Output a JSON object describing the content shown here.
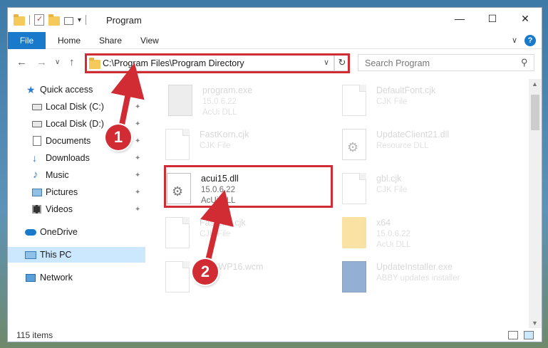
{
  "window": {
    "title": "Program",
    "minimize_glyph": "—",
    "maximize_glyph": "☐",
    "close_glyph": "✕"
  },
  "ribbon": {
    "file_tab": "File",
    "tabs": [
      "Home",
      "Share",
      "View"
    ],
    "help_glyph": "?",
    "expand_glyph": "∨"
  },
  "navigation": {
    "back_glyph": "←",
    "forward_glyph": "→",
    "recent_glyph": "∨",
    "up_glyph": "↑",
    "address": "C:\\Program Files\\Program Directory",
    "address_dropdown_glyph": "∨",
    "refresh_glyph": "↻",
    "search_placeholder": "Search Program",
    "search_glyph": "⚲"
  },
  "sidebar": {
    "items": [
      {
        "label": "Quick access",
        "icon": "star-icon"
      },
      {
        "label": "Local Disk (C:)",
        "icon": "drive-icon",
        "pinned": true
      },
      {
        "label": "Local Disk (D:)",
        "icon": "drive-icon",
        "pinned": true
      },
      {
        "label": "Documents",
        "icon": "documents-icon",
        "pinned": true
      },
      {
        "label": "Downloads",
        "icon": "download-icon",
        "pinned": true
      },
      {
        "label": "Music",
        "icon": "music-icon",
        "pinned": true
      },
      {
        "label": "Pictures",
        "icon": "pictures-icon",
        "pinned": true
      },
      {
        "label": "Videos",
        "icon": "videos-icon",
        "pinned": true
      },
      {
        "label": "OneDrive",
        "icon": "onedrive-icon"
      },
      {
        "label": "This PC",
        "icon": "pc-icon",
        "selected": true
      },
      {
        "label": "Network",
        "icon": "network-icon"
      }
    ],
    "pin_glyph": "📌"
  },
  "files": [
    {
      "name": "program.exe",
      "line1": "15.0.6.22",
      "line2": "AcUi DLL",
      "icon": "exe-icon"
    },
    {
      "name": "DefaultFont.cjk",
      "line1": "CJK File",
      "line2": "",
      "icon": "document-icon"
    },
    {
      "name": "FastKorn.cjk",
      "line1": "CJK File",
      "line2": "",
      "icon": "document-icon"
    },
    {
      "name": "UpdateClient21.dll",
      "line1": "Resource DLL",
      "line2": "",
      "icon": "dll-icon"
    },
    {
      "name": "acui15.dll",
      "line1": "15.0.6.22",
      "line2": "AcUi DLL",
      "icon": "dll-icon",
      "highlighted": true
    },
    {
      "name": "gbl.cjk",
      "line1": "CJK File",
      "line2": "",
      "icon": "document-icon"
    },
    {
      "name": "FastLtrd.cjk",
      "line1": "CJK File",
      "line2": "",
      "icon": "document-icon"
    },
    {
      "name": "x64",
      "line1": "15.0.6.22",
      "line2": "AcUi DLL",
      "icon": "folder-icon"
    },
    {
      "name": "ENUWP16.wcm",
      "line1": "",
      "line2": "",
      "icon": "document-icon"
    },
    {
      "name": "UpdateInstaller.exe",
      "line1": "ABBY updates installer",
      "line2": "",
      "icon": "installer-icon"
    }
  ],
  "status": {
    "item_count": "115 items"
  },
  "annotations": {
    "badge_1": "1",
    "badge_2": "2",
    "color": "#d12c34"
  },
  "colors": {
    "accent": "#1979ca",
    "selection": "#cce8ff",
    "highlight": "#d12c34"
  }
}
